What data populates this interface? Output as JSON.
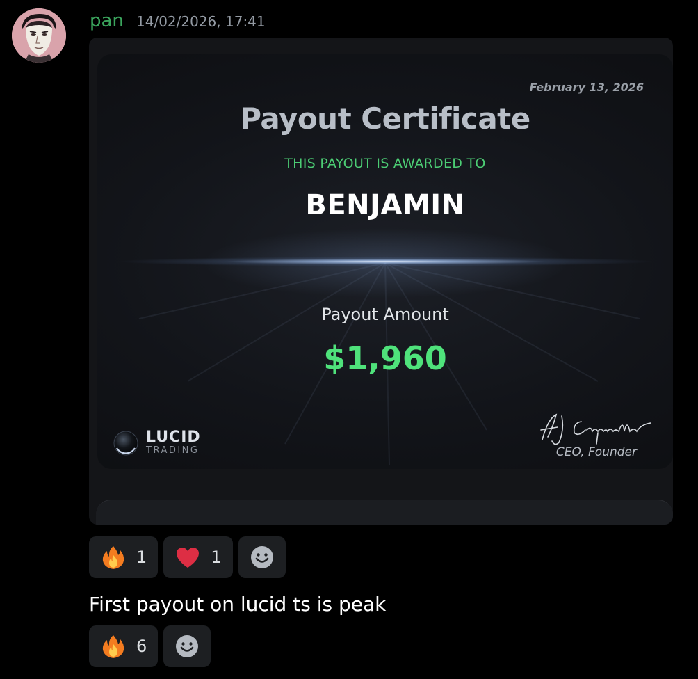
{
  "message_header": {
    "username": "pan",
    "timestamp": "14/02/2026, 17:41"
  },
  "certificate": {
    "date": "February 13, 2026",
    "title": "Payout Certificate",
    "awarded_label": "THIS PAYOUT IS AWARDED TO",
    "recipient": "BENJAMIN",
    "amount_label": "Payout Amount",
    "amount": "$1,960",
    "logo_name": "LUCID",
    "logo_sub": "TRADING",
    "signatory_title": "CEO, Founder",
    "accent_green": "#4fe27b"
  },
  "embed_reactions": [
    {
      "icon": "fire-emoji",
      "count": "1"
    },
    {
      "icon": "heart-emoji",
      "count": "1"
    }
  ],
  "message_text": "First payout on lucid ts is peak",
  "message_reactions": [
    {
      "icon": "fire-emoji",
      "count": "6"
    }
  ],
  "colors": {
    "username": "#3ba55d",
    "background": "#000000",
    "reaction_bg": "#1d1f22"
  }
}
